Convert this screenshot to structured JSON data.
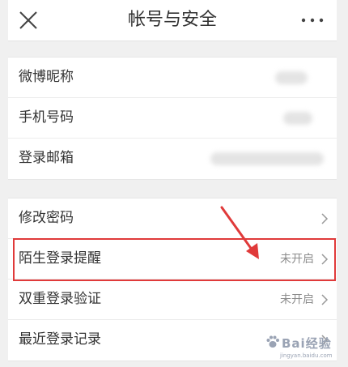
{
  "header": {
    "title": "帐号与安全"
  },
  "profile_group": [
    {
      "label": "微博昵称"
    },
    {
      "label": "手机号码"
    },
    {
      "label": "登录邮箱"
    }
  ],
  "security_group": [
    {
      "label": "修改密码",
      "value": ""
    },
    {
      "label": "陌生登录提醒",
      "value": "未开启"
    },
    {
      "label": "双重登录验证",
      "value": "未开启"
    },
    {
      "label": "最近登录记录",
      "value": ""
    }
  ],
  "annotation": {
    "highlight_color": "#e03a3a"
  },
  "watermark": {
    "main": "Bai经验",
    "sub": "jingyan.baidu.com"
  }
}
